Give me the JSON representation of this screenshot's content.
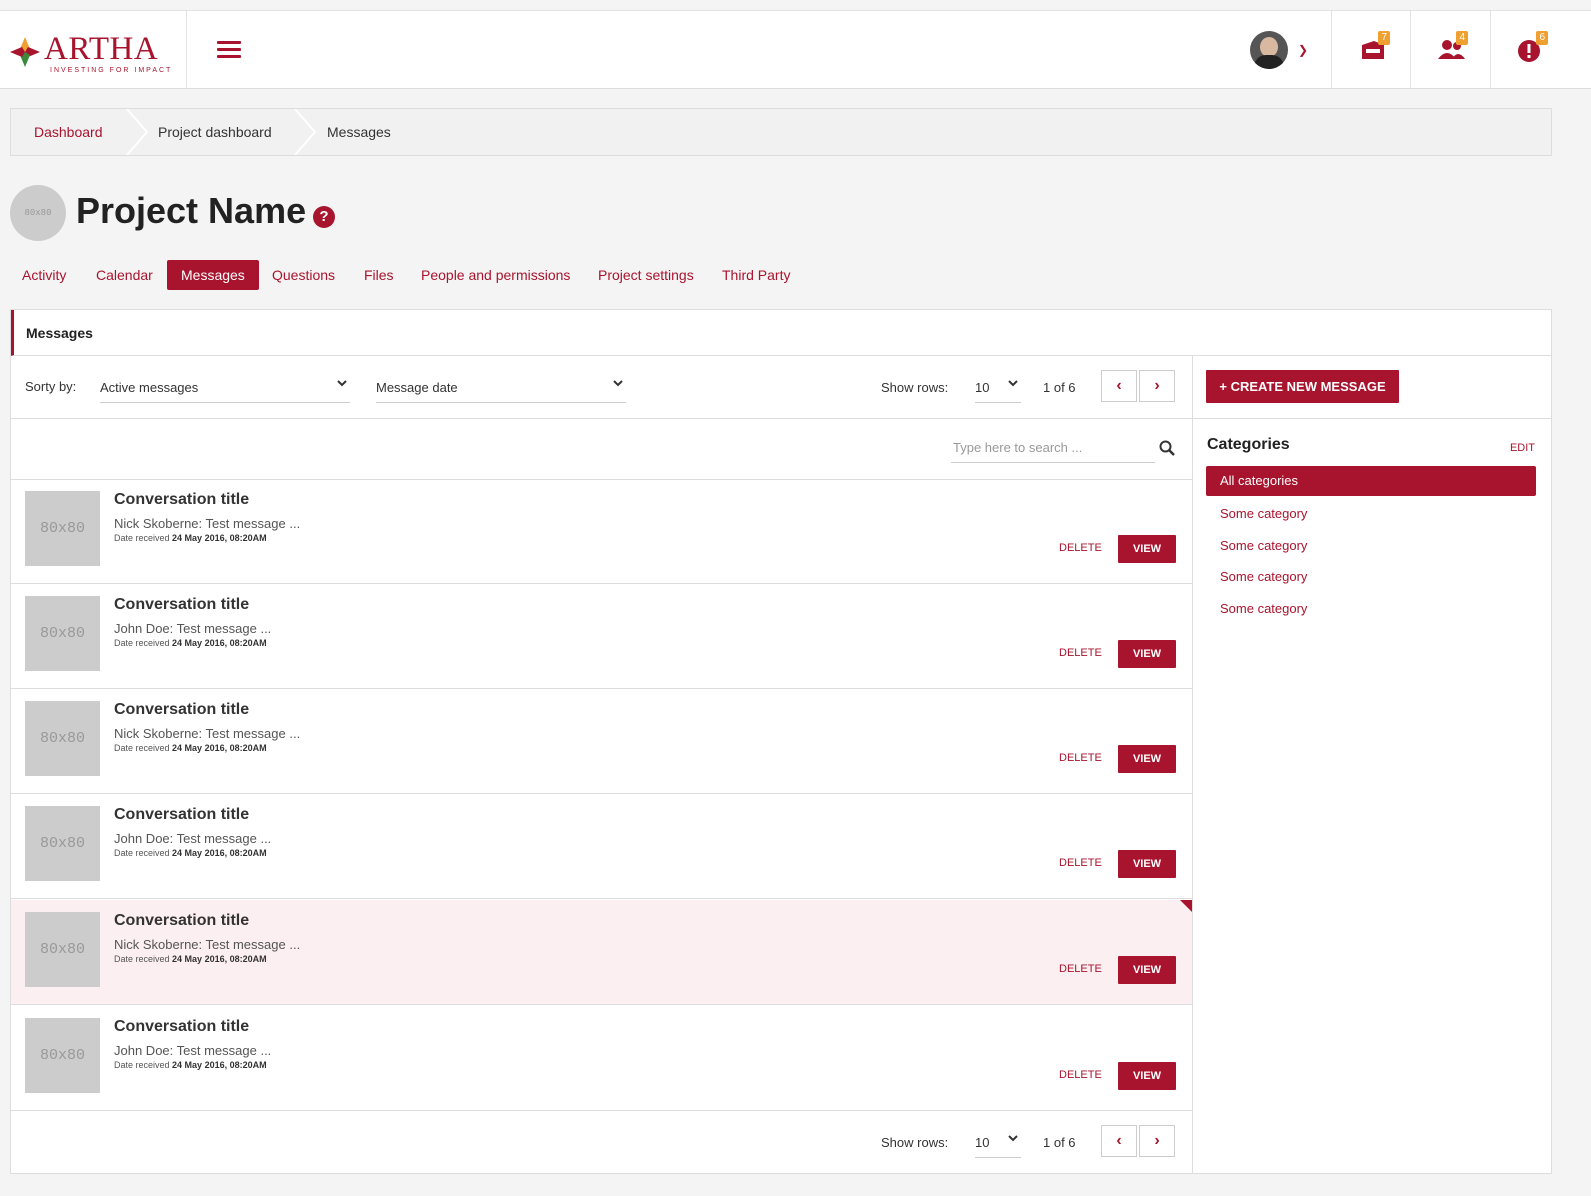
{
  "brand": {
    "name": "ARTHA",
    "tagline": "INVESTING FOR IMPACT",
    "accent": "#a8142e"
  },
  "topbar": {
    "notifications": [
      {
        "icon": "inbox-icon",
        "count": "7"
      },
      {
        "icon": "users-icon",
        "count": "4"
      },
      {
        "icon": "alert-icon",
        "count": "6"
      }
    ]
  },
  "breadcrumb": [
    "Dashboard",
    "Project dashboard",
    "Messages"
  ],
  "project": {
    "avatar": "80x80",
    "name": "Project Name",
    "help": "?"
  },
  "tabs": [
    {
      "label": "Activity"
    },
    {
      "label": "Calendar"
    },
    {
      "label": "Messages",
      "active": true
    },
    {
      "label": "Questions"
    },
    {
      "label": "Files"
    },
    {
      "label": "People and permissions"
    },
    {
      "label": "Project settings"
    },
    {
      "label": "Third Party"
    }
  ],
  "panel": {
    "title": "Messages"
  },
  "toolbar": {
    "sort_label": "Sorty by:",
    "sort_value": "Active messages",
    "date_value": "Message date",
    "show_rows_label": "Show rows:",
    "rows_value": "10",
    "page_info": "1 of 6"
  },
  "search": {
    "placeholder": "Type here to search ..."
  },
  "messages": [
    {
      "thumb": "80x80",
      "title": "Conversation title",
      "preview": "Nick Skoberne: Test message ...",
      "date_label": "Date received",
      "date": "24 May 2016, 08:20AM",
      "delete": "DELETE",
      "view": "VIEW"
    },
    {
      "thumb": "80x80",
      "title": "Conversation title",
      "preview": "John Doe: Test message ...",
      "date_label": "Date received",
      "date": "24 May 2016, 08:20AM",
      "delete": "DELETE",
      "view": "VIEW"
    },
    {
      "thumb": "80x80",
      "title": "Conversation title",
      "preview": "Nick Skoberne: Test message ...",
      "date_label": "Date received",
      "date": "24 May 2016, 08:20AM",
      "delete": "DELETE",
      "view": "VIEW"
    },
    {
      "thumb": "80x80",
      "title": "Conversation title",
      "preview": "John Doe: Test message ...",
      "date_label": "Date received",
      "date": "24 May 2016, 08:20AM",
      "delete": "DELETE",
      "view": "VIEW"
    },
    {
      "thumb": "80x80",
      "title": "Conversation title",
      "preview": "Nick Skoberne: Test message ...",
      "date_label": "Date received",
      "date": "24 May 2016, 08:20AM",
      "delete": "DELETE",
      "view": "VIEW",
      "highlighted": true
    },
    {
      "thumb": "80x80",
      "title": "Conversation title",
      "preview": "John Doe: Test message ...",
      "date_label": "Date received",
      "date": "24 May 2016, 08:20AM",
      "delete": "DELETE",
      "view": "VIEW"
    }
  ],
  "sidebar": {
    "create_button": "+ CREATE NEW MESSAGE",
    "categories_title": "Categories",
    "edit_label": "EDIT",
    "categories": [
      "All categories",
      "Some category",
      "Some category",
      "Some category",
      "Some category"
    ]
  }
}
